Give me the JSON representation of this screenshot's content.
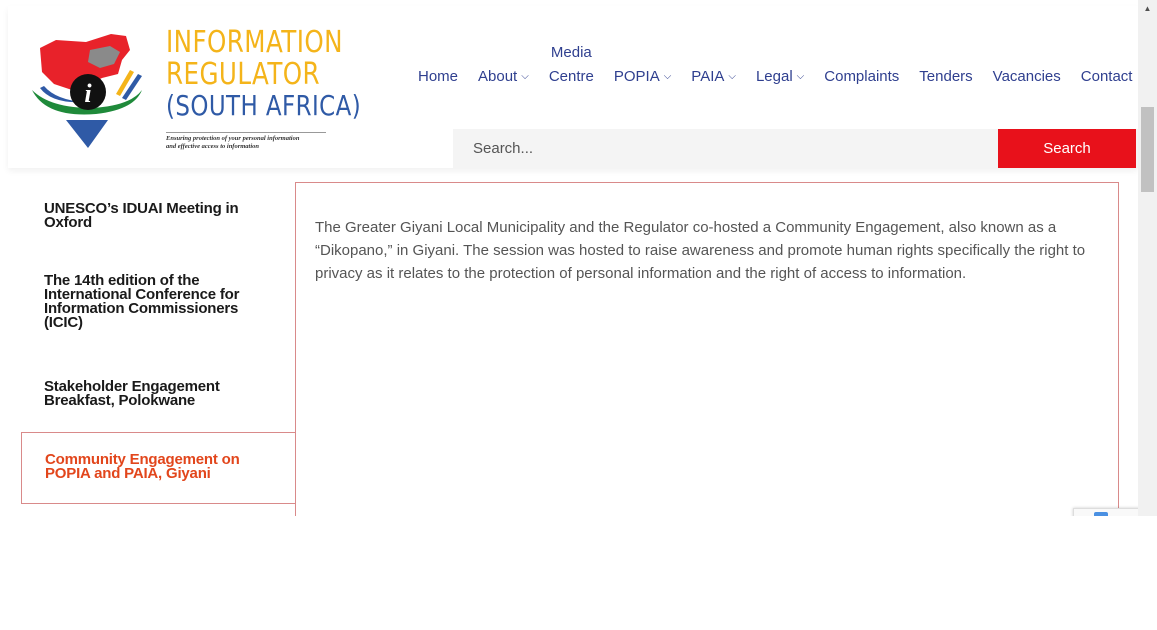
{
  "logo": {
    "line1": "INFORMATION",
    "line2": "REGULATOR",
    "line3": "(SOUTH AFRICA)",
    "tagline_1": "Ensuring protection of your personal information",
    "tagline_2": "and effective access to information"
  },
  "nav": {
    "home": "Home",
    "about": "About",
    "media_1": "Media",
    "media_2": "Centre",
    "popia": "POPIA",
    "paia": "PAIA",
    "legal": "Legal",
    "complaints": "Complaints",
    "tenders": "Tenders",
    "vacancies": "Vacancies",
    "contact": "Contact"
  },
  "search": {
    "placeholder": "Search...",
    "button": "Search"
  },
  "sidebar": {
    "items": [
      {
        "label": "UNESCO’s IDUAI Meeting in Oxford"
      },
      {
        "label": "The 14th edition of the International Conference for Information Commissioners (ICIC)"
      },
      {
        "label": "Stakeholder Engagement Breakfast, Polokwane"
      },
      {
        "label": "Community Engagement on POPIA and PAIA, Giyani"
      }
    ]
  },
  "content": {
    "body": "The Greater Giyani Local Municipality and the Regulator co-hosted a Community Engagement, also known as a “Dikopano,” in Giyani. The session was hosted to raise awareness and promote human rights specifically the right to privacy as it relates to the protection of personal information and the right of access to information."
  },
  "colors": {
    "accent_red": "#e8111b",
    "active_orange": "#e2461c",
    "nav_blue": "#2f3f8f",
    "logo_gold": "#f4b41a",
    "logo_blue": "#2f5aa6",
    "border_pink": "#d98a8a"
  }
}
